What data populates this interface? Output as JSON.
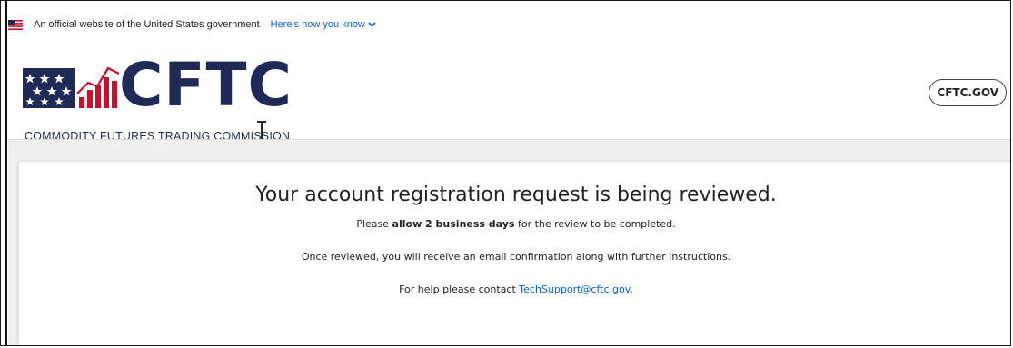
{
  "gov_banner": {
    "text": "An official website of the United States government",
    "link": "Here's how you know"
  },
  "logo": {
    "wordmark": "CFTC",
    "subtitle": "COMMODITY FUTURES TRADING COMMISSION"
  },
  "header": {
    "home_button": "CFTC.GOV"
  },
  "message": {
    "title": "Your account registration request is being reviewed.",
    "line1_prefix": "Please ",
    "line1_bold": "allow 2 business days",
    "line1_suffix": " for the review to be completed.",
    "line2": "Once reviewed, you will receive an email confirmation along with further instructions.",
    "line3_prefix": "For help please contact ",
    "line3_email": "TechSupport@cftc.gov",
    "line3_suffix": "."
  },
  "colors": {
    "navy": "#1f2b56",
    "red": "#c8102e",
    "link": "#0b5fd8"
  }
}
